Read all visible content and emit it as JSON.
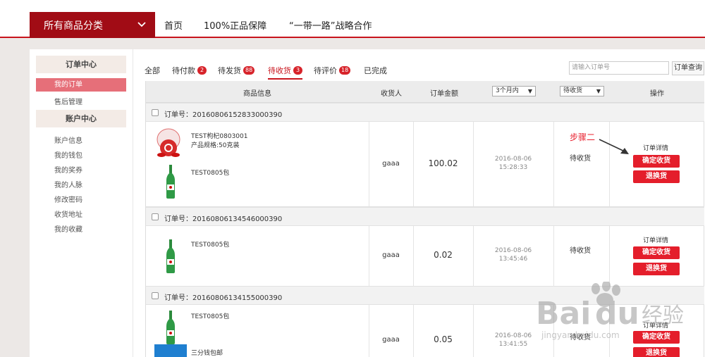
{
  "nav": {
    "category_label": "所有商品分类",
    "links": [
      "首页",
      "100%正品保障",
      "“一带一路”战略合作"
    ]
  },
  "sidebar": {
    "order_center": "订单中心",
    "order_items": [
      "我的订单",
      "售后管理"
    ],
    "account_center": "账户中心",
    "account_items": [
      "账户信息",
      "我的钱包",
      "我的奖券",
      "我的人脉",
      "修改密码",
      "收货地址",
      "我的收藏"
    ]
  },
  "tabs": [
    {
      "label": "全部",
      "badge": ""
    },
    {
      "label": "待付款",
      "badge": "2"
    },
    {
      "label": "待发货",
      "badge": "88"
    },
    {
      "label": "待收货",
      "badge": "3"
    },
    {
      "label": "待评价",
      "badge": "18"
    },
    {
      "label": "已完成",
      "badge": ""
    }
  ],
  "search": {
    "placeholder": "请输入订单号",
    "button": "订单查询"
  },
  "table": {
    "headers": {
      "product": "商品信息",
      "consignee": "收货人",
      "amount": "订单金额",
      "time_filter": "3个月内",
      "status_filter": "待收货",
      "action": "操作"
    },
    "order_no_prefix": "订单号："
  },
  "orders": [
    {
      "order_no": "20160806152833000390",
      "products": [
        {
          "name": "TEST枸杞0803001",
          "spec": "产品规格:50克装"
        },
        {
          "name": "TEST0805包",
          "spec": ""
        }
      ],
      "consignee": "gaaa",
      "amount": "100.02",
      "date": "2016-08-06",
      "time": "15:28:33",
      "status": "待收货"
    },
    {
      "order_no": "20160806134546000390",
      "products": [
        {
          "name": "TEST0805包",
          "spec": ""
        }
      ],
      "consignee": "gaaa",
      "amount": "0.02",
      "date": "2016-08-06",
      "time": "13:45:46",
      "status": "待收货"
    },
    {
      "order_no": "20160806134155000390",
      "products": [
        {
          "name": "TEST0805包",
          "spec": ""
        },
        {
          "name": "三分钱包邮",
          "spec": ""
        }
      ],
      "consignee": "gaaa",
      "amount": "0.05",
      "date": "2016-08-06",
      "time": "13:41:55",
      "status": "待收货"
    }
  ],
  "actions": {
    "detail": "订单详情",
    "confirm": "确定收货",
    "return": "退换货"
  },
  "annotation": "步骤二",
  "watermark": {
    "brand": "Baidu",
    "cn": "经验",
    "url": "jingyan.baidu.com"
  }
}
